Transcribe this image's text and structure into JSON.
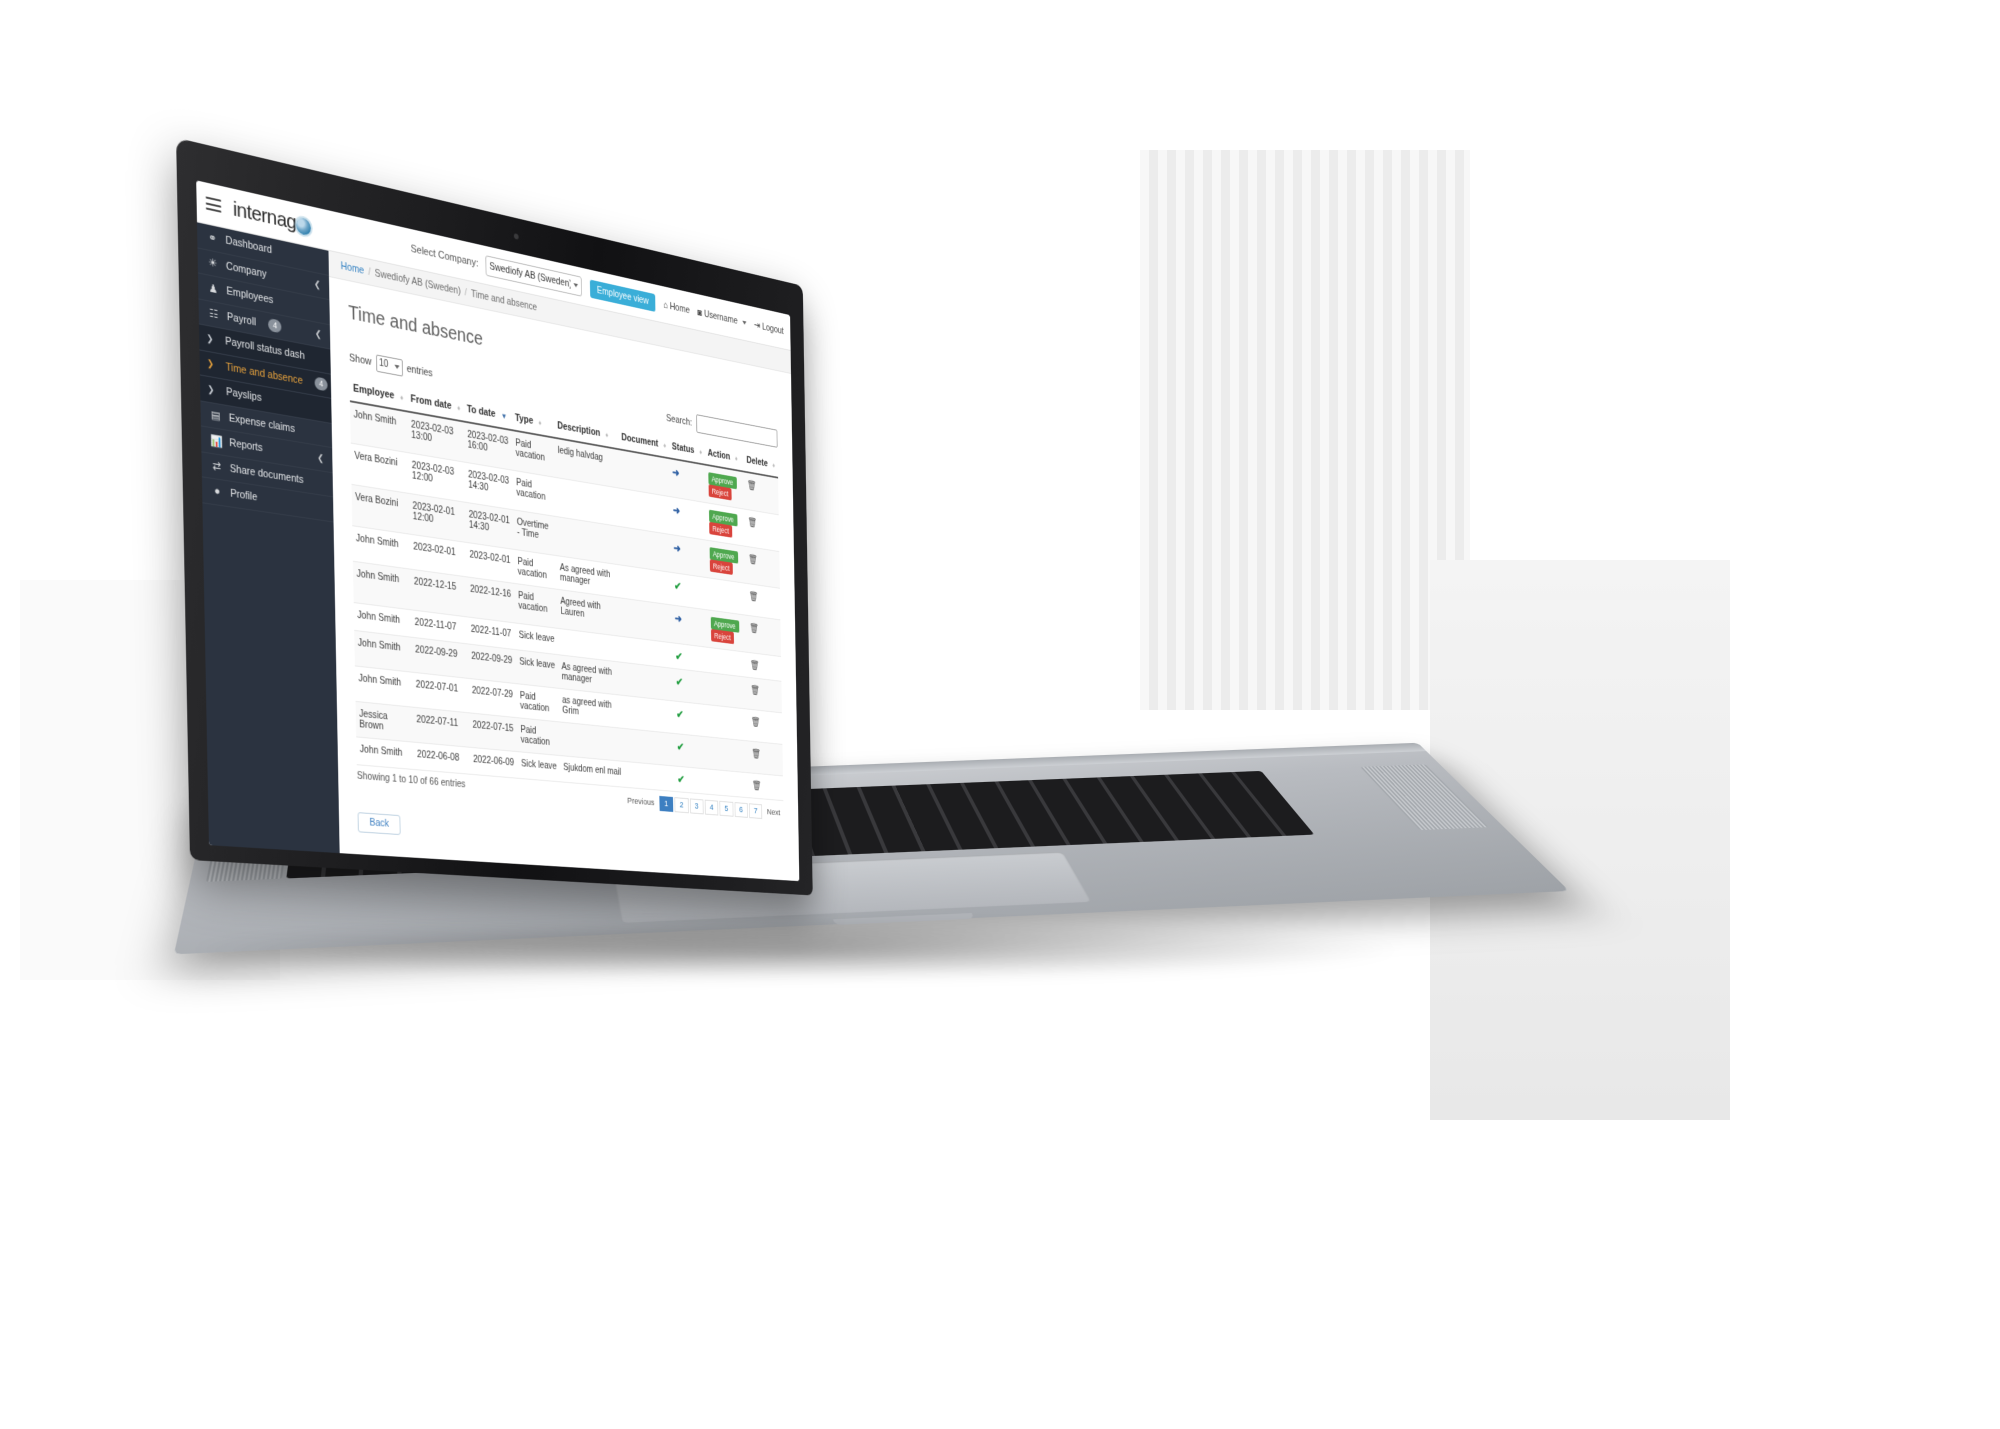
{
  "navbar": {
    "menu_icon": "hamburger-icon",
    "brand": "internago",
    "brand_main": "interna",
    "brand_go": "go",
    "select_company_label": "Select Company:",
    "company_value": "Swediofy AB (Sweden)",
    "employee_view_button": "Employee view",
    "home_link": "Home",
    "username_link": "Username",
    "logout_link": "Logout"
  },
  "sidebar": {
    "items": [
      {
        "label": "Dashboard",
        "icon": "dashboard-icon",
        "glyph": "☸",
        "badge": "",
        "arrow": ""
      },
      {
        "label": "Company",
        "icon": "globe-icon",
        "glyph": "◔",
        "badge": "",
        "arrow": "❮"
      },
      {
        "label": "Employees",
        "icon": "people-icon",
        "glyph": "⛟",
        "badge": "",
        "arrow": ""
      },
      {
        "label": "Payroll",
        "icon": "payroll-icon",
        "glyph": "☰",
        "badge": "4",
        "arrow": "❮"
      }
    ],
    "sub_items": [
      {
        "label": "Payroll status dash",
        "badge": "",
        "active": false
      },
      {
        "label": "Time and absence",
        "badge": "4",
        "active": true
      },
      {
        "label": "Payslips",
        "badge": "",
        "active": false
      }
    ],
    "items_bottom": [
      {
        "label": "Expense claims",
        "icon": "receipt-icon",
        "glyph": "▤",
        "badge": "",
        "arrow": ""
      },
      {
        "label": "Reports",
        "icon": "chart-icon",
        "glyph": "▖",
        "badge": "",
        "arrow": "❮"
      },
      {
        "label": "Share documents",
        "icon": "share-icon",
        "glyph": "⇄",
        "badge": "",
        "arrow": ""
      },
      {
        "label": "Profile",
        "icon": "user-icon",
        "glyph": "●",
        "badge": "",
        "arrow": ""
      }
    ]
  },
  "breadcrumb": {
    "home": "Home",
    "company": "Swediofy AB (Sweden)",
    "current": "Time and absence"
  },
  "page": {
    "title": "Time and absence",
    "show_label": "Show",
    "entries_length": "10",
    "entries_label": "entries",
    "search_label": "Search:",
    "search_value": "",
    "back_button": "Back",
    "showing_text": "Showing 1 to 10 of 66 entries"
  },
  "table": {
    "columns": [
      "Employee",
      "From date",
      "To date",
      "Type",
      "Description",
      "Document",
      "Status",
      "Action",
      "Delete"
    ],
    "sorted_column": "To date",
    "approve_label": "Approve",
    "reject_label": "Reject",
    "rows": [
      {
        "employee": "John Smith",
        "from": "2023-02-03 13:00",
        "to": "2023-02-03 16:00",
        "type": "Paid vacation",
        "description": "ledig halvdag",
        "document": "",
        "status": "pending",
        "actions": true
      },
      {
        "employee": "Vera Bozini",
        "from": "2023-02-03 12:00",
        "to": "2023-02-03 14:30",
        "type": "Paid vacation",
        "description": "",
        "document": "",
        "status": "pending",
        "actions": true
      },
      {
        "employee": "Vera Bozini",
        "from": "2023-02-01 12:00",
        "to": "2023-02-01 14:30",
        "type": "Overtime - Time",
        "description": "",
        "document": "",
        "status": "pending",
        "actions": true
      },
      {
        "employee": "John Smith",
        "from": "2023-02-01",
        "to": "2023-02-01",
        "type": "Paid vacation",
        "description": "As agreed with manager",
        "document": "",
        "status": "approved",
        "actions": false
      },
      {
        "employee": "John Smith",
        "from": "2022-12-15",
        "to": "2022-12-16",
        "type": "Paid vacation",
        "description": "Agreed with Lauren",
        "document": "",
        "status": "pending",
        "actions": true
      },
      {
        "employee": "John Smith",
        "from": "2022-11-07",
        "to": "2022-11-07",
        "type": "Sick leave",
        "description": "",
        "document": "",
        "status": "approved",
        "actions": false
      },
      {
        "employee": "John Smith",
        "from": "2022-09-29",
        "to": "2022-09-29",
        "type": "Sick leave",
        "description": "As agreed with manager",
        "document": "",
        "status": "approved",
        "actions": false
      },
      {
        "employee": "John Smith",
        "from": "2022-07-01",
        "to": "2022-07-29",
        "type": "Paid vacation",
        "description": "as agreed with Grim",
        "document": "",
        "status": "approved",
        "actions": false
      },
      {
        "employee": "Jessica Brown",
        "from": "2022-07-11",
        "to": "2022-07-15",
        "type": "Paid vacation",
        "description": "",
        "document": "",
        "status": "approved",
        "actions": false
      },
      {
        "employee": "John Smith",
        "from": "2022-06-08",
        "to": "2022-06-09",
        "type": "Sick leave",
        "description": "Sjukdom enl mail",
        "document": "",
        "status": "approved",
        "actions": false
      }
    ]
  },
  "pagination": {
    "previous": "Previous",
    "next": "Next",
    "pages": [
      "1",
      "2",
      "3",
      "4",
      "5",
      "6",
      "7"
    ],
    "current": "1"
  },
  "colors": {
    "sidebar_bg": "#2b3340",
    "sidebar_sub_bg": "#1f2631",
    "accent_orange": "#e8a33d",
    "link_blue": "#2f7fc1",
    "approve_green": "#4fa84f",
    "reject_red": "#d9443c",
    "employee_view_blue": "#3aaed8"
  }
}
